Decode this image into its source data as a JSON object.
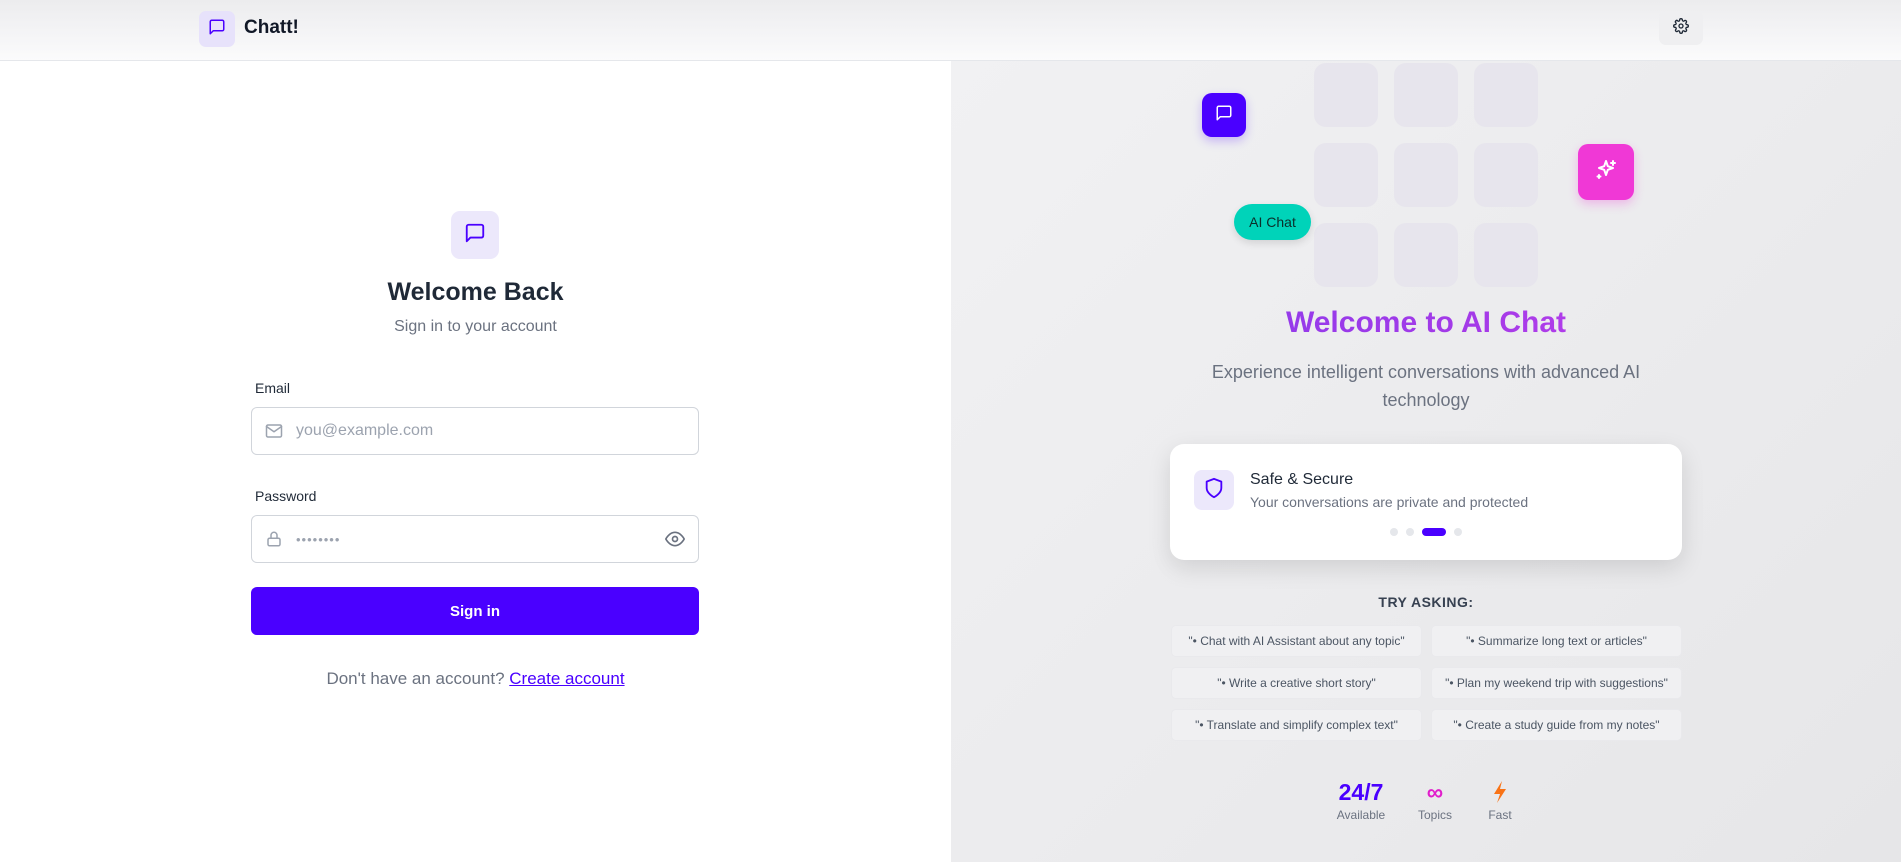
{
  "header": {
    "brand_name": "Chatt!",
    "brand_icon": "message-square-icon",
    "settings_icon": "gear-icon"
  },
  "login": {
    "logo_icon": "message-square-icon",
    "title": "Welcome Back",
    "subtitle": "Sign in to your account",
    "email_label": "Email",
    "email_placeholder": "you@example.com",
    "email_icon": "mail-icon",
    "password_label": "Password",
    "password_value": "••••••••",
    "password_icon": "lock-icon",
    "password_toggle_icon": "eye-icon",
    "signin_label": "Sign in",
    "no_account_text": "Don't have an account?",
    "create_account_label": "Create account"
  },
  "hero": {
    "floating_chat_icon": "message-square-icon",
    "floating_spark_icon": "sparkles-icon",
    "pill_label": "AI Chat",
    "title": "Welcome to AI Chat",
    "subtitle": "Experience intelligent conversations with advanced AI technology",
    "feature": {
      "icon": "shield-icon",
      "title": "Safe & Secure",
      "description": "Your conversations are private and protected"
    },
    "carousel": {
      "count": 4,
      "active_index": 2
    },
    "try_label": "TRY ASKING:",
    "suggestions": [
      "\"• Chat with AI Assistant about any topic\"",
      "\"• Summarize long text or articles\"",
      "\"• Write a creative short story\"",
      "\"• Plan my weekend trip with suggestions\"",
      "\"• Translate and simplify complex text\"",
      "\"• Create a study guide from my notes\""
    ],
    "stats": [
      {
        "value": "24/7",
        "label": "Available",
        "color": "#4a00ff"
      },
      {
        "value": "∞",
        "label": "Topics",
        "color": "#e11dcb"
      },
      {
        "value": "",
        "icon": "lightning-icon",
        "label": "Fast",
        "color": "#f97316"
      }
    ]
  },
  "colors": {
    "primary": "#4a00ff",
    "accent_pink": "#f038d6",
    "accent_teal": "#00d3b9"
  }
}
